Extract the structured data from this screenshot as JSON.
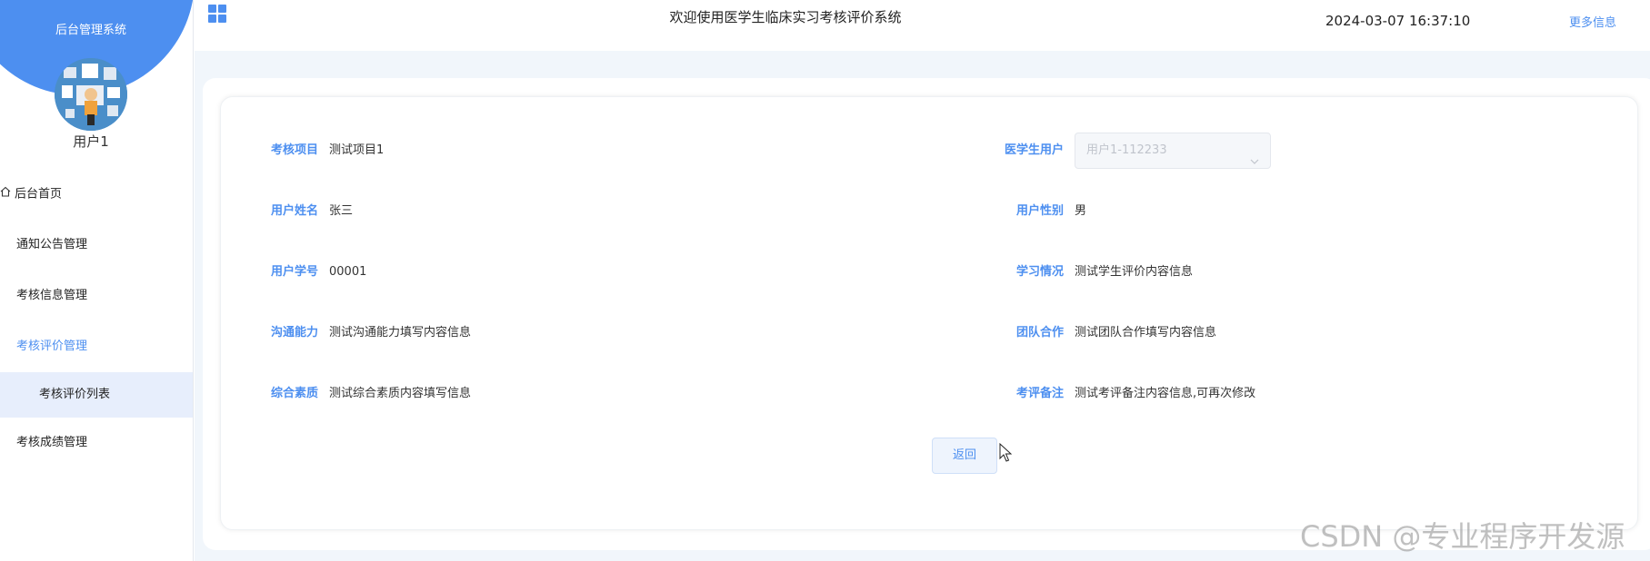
{
  "sidebar": {
    "system_title": "后台管理系统",
    "user_name": "用户1",
    "menu": {
      "home": "后台首页",
      "notice": "通知公告管理",
      "exam_info": "考核信息管理",
      "exam_eval": "考核评价管理",
      "exam_eval_list": "考核评价列表",
      "exam_score": "考核成绩管理"
    }
  },
  "header": {
    "welcome": "欢迎使用医学生临床实习考核评价系统",
    "datetime": "2024-03-07 16:37:10",
    "more_info": "更多信息"
  },
  "form": {
    "project": {
      "label": "考核项目",
      "value": "测试项目1"
    },
    "student_user": {
      "label": "医学生用户",
      "placeholder": "用户1-112233"
    },
    "user_name": {
      "label": "用户姓名",
      "value": "张三"
    },
    "gender": {
      "label": "用户性别",
      "value": "男"
    },
    "student_id": {
      "label": "用户学号",
      "value": "00001"
    },
    "study": {
      "label": "学习情况",
      "value": "测试学生评价内容信息"
    },
    "communication": {
      "label": "沟通能力",
      "value": "测试沟通能力填写内容信息"
    },
    "teamwork": {
      "label": "团队合作",
      "value": "测试团队合作填写内容信息"
    },
    "quality": {
      "label": "综合素质",
      "value": "测试综合素质内容填写信息"
    },
    "remark": {
      "label": "考评备注",
      "value": "测试考评备注内容信息,可再次修改"
    },
    "back_label": "返回"
  },
  "watermark": "CSDN @专业程序开发源",
  "colors": {
    "accent": "#4d8ff0",
    "active_bg": "#e7eefc",
    "page_bg": "#f1f6fb"
  },
  "icons": [
    "grid-icon",
    "home-icon",
    "chevron-down-icon",
    "cursor-icon"
  ]
}
